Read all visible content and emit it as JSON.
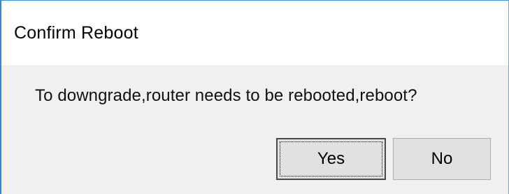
{
  "dialog": {
    "title": "Confirm Reboot",
    "message": "To downgrade,router needs to be rebooted,reboot?",
    "buttons": {
      "yes_label": "Yes",
      "no_label": "No"
    },
    "colors": {
      "window_border": "#2f8ad8",
      "title_bar_bg": "#ffffff",
      "body_bg": "#f0f0f0",
      "button_bg": "#e1e1e1"
    }
  }
}
